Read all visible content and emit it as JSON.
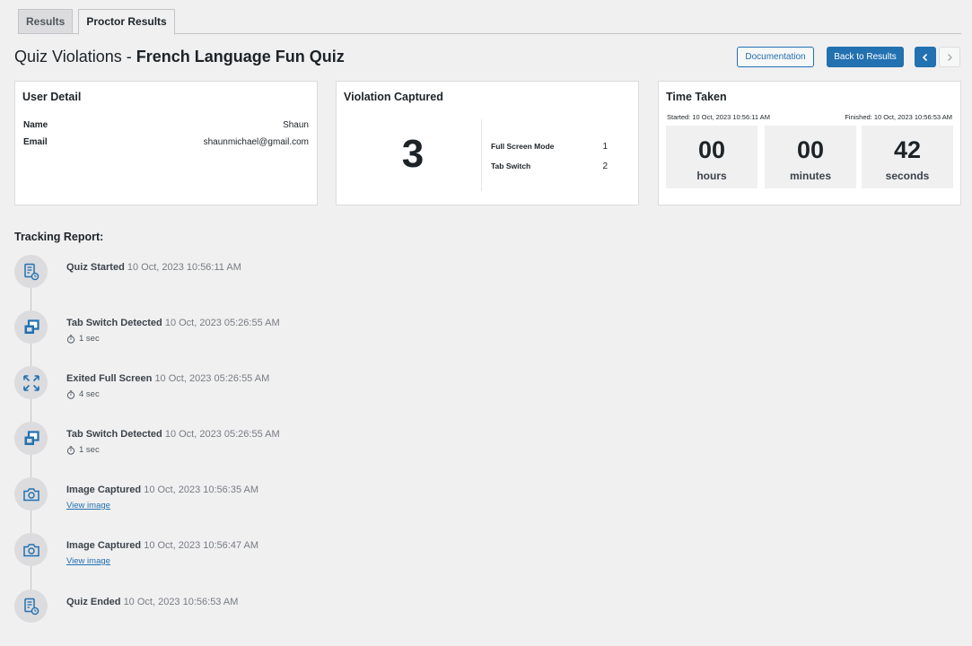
{
  "tabs": [
    {
      "label": "Results",
      "active": false
    },
    {
      "label": "Proctor Results",
      "active": true
    }
  ],
  "header": {
    "title_prefix": "Quiz Violations - ",
    "quiz_name": "French Language Fun Quiz",
    "documentation_label": "Documentation",
    "back_label": "Back to Results",
    "prev_icon": "chevron-left-icon",
    "next_icon": "chevron-right-icon"
  },
  "user_detail": {
    "title": "User Detail",
    "name_label": "Name",
    "name_value": "Shaun",
    "email_label": "Email",
    "email_value": "shaunmichael@gmail.com"
  },
  "violations": {
    "title": "Violation Captured",
    "total": "3",
    "items": [
      {
        "label": "Full Screen Mode",
        "count": "1"
      },
      {
        "label": "Tab Switch",
        "count": "2"
      }
    ]
  },
  "time_taken": {
    "title": "Time Taken",
    "started": "Started: 10 Oct, 2023 10:56:11 AM",
    "finished": "Finished: 10 Oct, 2023 10:56:53 AM",
    "hours": "00",
    "hours_label": "hours",
    "minutes": "00",
    "minutes_label": "minutes",
    "seconds": "42",
    "seconds_label": "seconds"
  },
  "report": {
    "title": "Tracking Report:",
    "events": [
      {
        "title": "Quiz Started",
        "time": "10 Oct, 2023 10:56:11 AM",
        "icon": "quiz-document-icon"
      },
      {
        "title": "Tab Switch Detected",
        "time": "10 Oct, 2023 05:26:55 AM",
        "duration": "1 sec",
        "icon": "tab-switch-icon"
      },
      {
        "title": "Exited Full Screen",
        "time": "10 Oct, 2023 05:26:55 AM",
        "duration": "4 sec",
        "icon": "exit-fullscreen-icon"
      },
      {
        "title": "Tab Switch Detected",
        "time": "10 Oct, 2023 05:26:55 AM",
        "duration": "1 sec",
        "icon": "tab-switch-icon"
      },
      {
        "title": "Image Captured",
        "time": "10 Oct, 2023 10:56:35 AM",
        "link": "View image",
        "icon": "camera-icon"
      },
      {
        "title": "Image Captured",
        "time": "10 Oct, 2023 10:56:47 AM",
        "link": "View image",
        "icon": "camera-icon"
      },
      {
        "title": "Quiz Ended",
        "time": "10 Oct, 2023 10:56:53 AM",
        "icon": "quiz-document-icon"
      }
    ]
  },
  "colors": {
    "accent": "#2271b1",
    "background": "#f0f0f1"
  }
}
